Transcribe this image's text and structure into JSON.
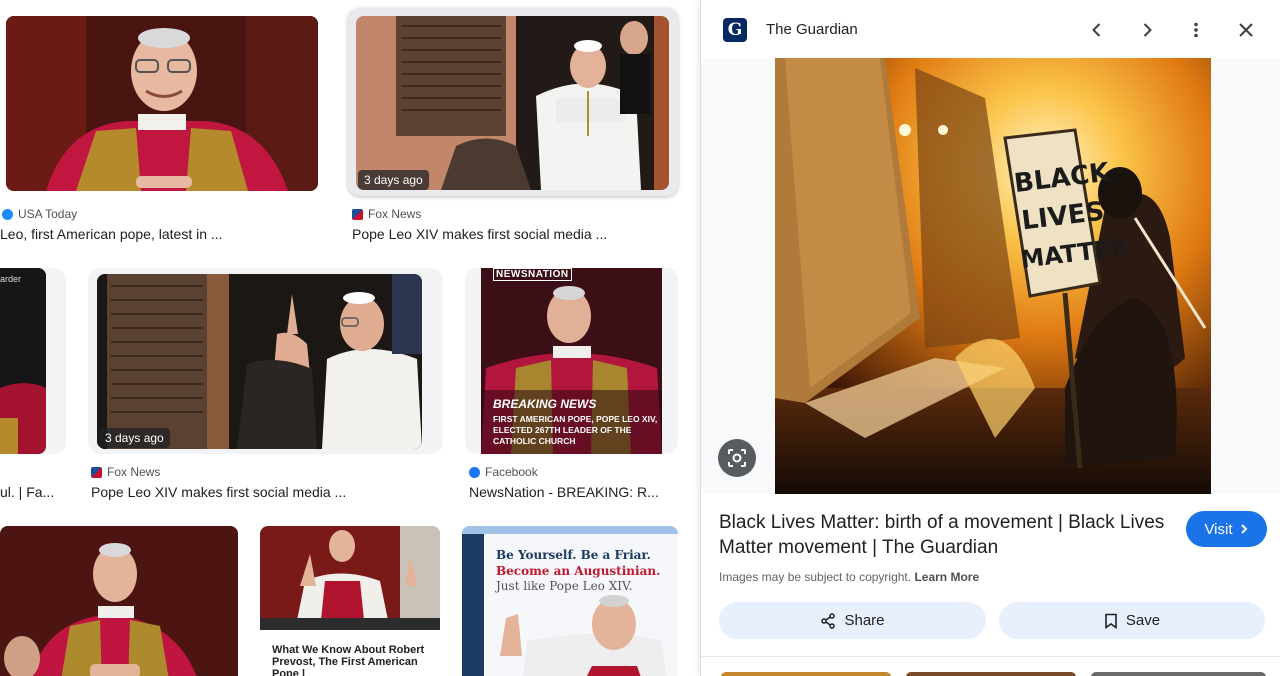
{
  "results": {
    "row1": [
      {
        "source": "USA Today",
        "title": "Leo, first American pope, latest in ..."
      },
      {
        "source": "Fox News",
        "title": "Pope Leo XIV makes first social media ...",
        "age": "3 days ago"
      }
    ],
    "row2": [
      {
        "source": "",
        "title": "ul. | Fa...",
        "corner_text": "arder"
      },
      {
        "source": "Fox News",
        "title": "Pope Leo XIV makes first social media ...",
        "age": "3 days ago"
      },
      {
        "source": "Facebook",
        "title": "NewsNation - BREAKING: R...",
        "brand": "NEWSNATION",
        "headline": "BREAKING NEWS",
        "subline": "FIRST AMERICAN POPE, POPE LEO XIV, ELECTED 267TH LEADER OF THE CATHOLIC CHURCH"
      }
    ],
    "row3": [
      {
        "title": ""
      },
      {
        "caption": "What We Know About Robert Prevost, The First American Pope |"
      },
      {
        "line1": "Be Yourself. Be a Friar.",
        "line2": "Become an Augustinian.",
        "line3": "Just like Pope Leo XIV."
      }
    ]
  },
  "panel": {
    "logo_letter": "G",
    "source": "The Guardian",
    "sign_text": [
      "BLACK",
      "LIVES",
      "MATTER"
    ],
    "title": "Black Lives Matter: birth of a movement | Black Lives Matter movement | The Guardian",
    "visit_label": "Visit",
    "copyright_text": "Images may be subject to copyright.",
    "learn_more": "Learn More",
    "share_label": "Share",
    "save_label": "Save"
  },
  "colors": {
    "accent": "#1a73e8",
    "action_bg": "#e8f0fe",
    "red_vestment": "#b5123a",
    "fire": "#f29a1c"
  },
  "icons": [
    "prev-icon",
    "next-icon",
    "more-icon",
    "close-icon",
    "lens-icon",
    "share-icon",
    "bookmark-icon",
    "chevron-right-icon"
  ]
}
